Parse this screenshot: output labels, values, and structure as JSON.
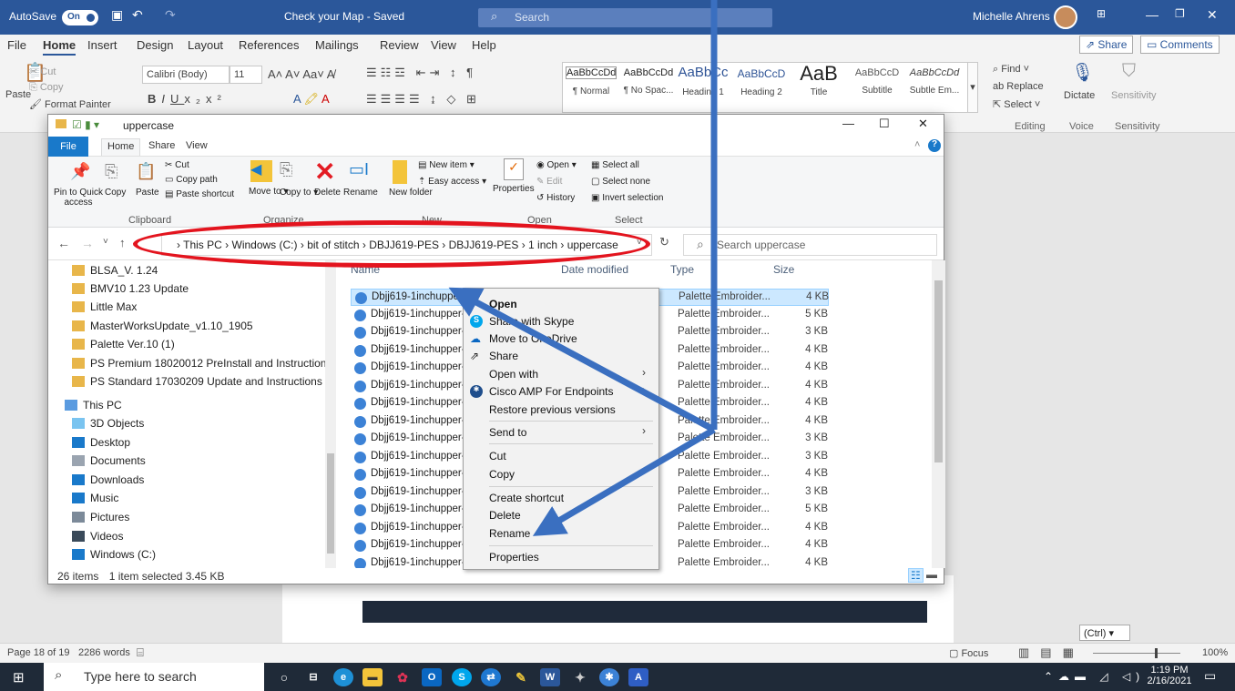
{
  "word": {
    "autosave_label": "AutoSave",
    "autosave_state": "On",
    "doc_title": "Check your Map - Saved",
    "search_placeholder": "Search",
    "user_name": "Michelle Ahrens",
    "menu": [
      "File",
      "Home",
      "Insert",
      "Design",
      "Layout",
      "References",
      "Mailings",
      "Review",
      "View",
      "Help"
    ],
    "share_label": "Share",
    "comments_label": "Comments",
    "clipboard": {
      "paste": "Paste",
      "cut": "Cut",
      "copy": "Copy",
      "format_painter": "Format Painter"
    },
    "font_name": "Calibri (Body)",
    "font_size": "11",
    "styles": [
      {
        "preview": "AaBbCcDd",
        "name": "¶ Normal"
      },
      {
        "preview": "AaBbCcDd",
        "name": "¶ No Spac..."
      },
      {
        "preview": "AaBbCc",
        "name": "Heading 1"
      },
      {
        "preview": "AaBbCcD",
        "name": "Heading 2"
      },
      {
        "preview": "AaB",
        "name": "Title"
      },
      {
        "preview": "AaBbCcD",
        "name": "Subtitle"
      },
      {
        "preview": "AaBbCcDd",
        "name": "Subtle Em..."
      }
    ],
    "editing": {
      "find": "Find",
      "replace": "Replace",
      "select": "Select",
      "group": "Editing"
    },
    "voice": {
      "dictate": "Dictate",
      "group": "Voice"
    },
    "sensitivity": {
      "label": "Sensitivity",
      "group": "Sensitivity"
    },
    "status": {
      "page": "Page 18 of 19",
      "words": "2286 words",
      "focus": "Focus",
      "zoom": "100%"
    },
    "ctrl_tip": "(Ctrl)"
  },
  "explorer": {
    "title": "uppercase",
    "tabs": {
      "file": "File",
      "home": "Home",
      "share": "Share",
      "view": "View"
    },
    "ribbon": {
      "pin": "Pin to Quick access",
      "copy": "Copy",
      "paste": "Paste",
      "cut": "Cut",
      "copy_path": "Copy path",
      "paste_shortcut": "Paste shortcut",
      "move_to": "Move to",
      "copy_to": "Copy to",
      "delete": "Delete",
      "rename": "Rename",
      "new_folder": "New folder",
      "new_item": "New item",
      "easy_access": "Easy access",
      "properties": "Properties",
      "open": "Open",
      "edit": "Edit",
      "history": "History",
      "select_all": "Select all",
      "select_none": "Select none",
      "invert_selection": "Invert selection",
      "groups": {
        "clipboard": "Clipboard",
        "organize": "Organize",
        "new": "New",
        "open": "Open",
        "select": "Select"
      }
    },
    "breadcrumb": [
      "This PC",
      "Windows (C:)",
      "bit of stitch",
      "DBJJ619-PES",
      "DBJJ619-PES",
      "1 inch",
      "uppercase"
    ],
    "search_placeholder": "Search uppercase",
    "nav_items": [
      {
        "label": "BLSA_V. 1.24",
        "icon": "folder-zip-icon"
      },
      {
        "label": "BMV10 1.23 Update",
        "icon": "folder-zip-icon"
      },
      {
        "label": "Little Max",
        "icon": "folder-zip-icon"
      },
      {
        "label": "MasterWorksUpdate_v1.10_1905",
        "icon": "folder-zip-icon"
      },
      {
        "label": "Palette Ver.10 (1)",
        "icon": "folder-zip-icon"
      },
      {
        "label": "PS Premium 18020012 PreInstall and Instructions",
        "icon": "folder-zip-icon"
      },
      {
        "label": "PS Standard 17030209 Update and Instructions",
        "icon": "folder-zip-icon"
      },
      {
        "label": "This PC",
        "icon": "computer-icon"
      },
      {
        "label": "3D Objects",
        "icon": "3d-objects-icon"
      },
      {
        "label": "Desktop",
        "icon": "desktop-icon"
      },
      {
        "label": "Documents",
        "icon": "documents-icon"
      },
      {
        "label": "Downloads",
        "icon": "downloads-icon"
      },
      {
        "label": "Music",
        "icon": "music-icon"
      },
      {
        "label": "Pictures",
        "icon": "pictures-icon"
      },
      {
        "label": "Videos",
        "icon": "videos-icon"
      },
      {
        "label": "Windows (C:)",
        "icon": "drive-icon"
      }
    ],
    "columns": {
      "name": "Name",
      "date": "Date modified",
      "type": "Type",
      "size": "Size"
    },
    "files": [
      {
        "name": "Dbjj619-1inchupper-A",
        "type": "Palette Embroider...",
        "size": "4 KB",
        "selected": true
      },
      {
        "name": "Dbjj619-1inchupper-B",
        "type": "Palette Embroider...",
        "size": "5 KB"
      },
      {
        "name": "Dbjj619-1inchupper-C",
        "type": "Palette Embroider...",
        "size": "3 KB"
      },
      {
        "name": "Dbjj619-1inchupper-D",
        "type": "Palette Embroider...",
        "size": "4 KB"
      },
      {
        "name": "Dbjj619-1inchupper-E",
        "type": "Palette Embroider...",
        "size": "4 KB"
      },
      {
        "name": "Dbjj619-1inchupper-F",
        "type": "Palette Embroider...",
        "size": "4 KB"
      },
      {
        "name": "Dbjj619-1inchupper-G",
        "type": "Palette Embroider...",
        "size": "4 KB"
      },
      {
        "name": "Dbjj619-1inchupper-H",
        "type": "Palette Embroider...",
        "size": "4 KB"
      },
      {
        "name": "Dbjj619-1inchupper-I",
        "type": "Palette Embroider...",
        "size": "3 KB"
      },
      {
        "name": "Dbjj619-1inchupper-J",
        "type": "Palette Embroider...",
        "size": "3 KB"
      },
      {
        "name": "Dbjj619-1inchupper-K",
        "type": "Palette Embroider...",
        "size": "4 KB"
      },
      {
        "name": "Dbjj619-1inchupper-L",
        "type": "Palette Embroider...",
        "size": "3 KB"
      },
      {
        "name": "Dbjj619-1inchupper-M",
        "type": "Palette Embroider...",
        "size": "5 KB"
      },
      {
        "name": "Dbjj619-1inchupper-N",
        "type": "Palette Embroider...",
        "size": "4 KB"
      },
      {
        "name": "Dbjj619-1inchupper-O",
        "type": "Palette Embroider...",
        "size": "4 KB"
      },
      {
        "name": "Dbjj619-1inchupper-P",
        "type": "Palette Embroider...",
        "size": "4 KB"
      }
    ],
    "status": {
      "items": "26 items",
      "selected": "1 item selected 3.45 KB"
    }
  },
  "context_menu": {
    "open": "Open",
    "share_skype": "Share with Skype",
    "onedrive": "Move to OneDrive",
    "share": "Share",
    "open_with": "Open with",
    "cisco": "Cisco AMP For Endpoints",
    "restore": "Restore previous versions",
    "send_to": "Send to",
    "cut": "Cut",
    "copy": "Copy",
    "create_shortcut": "Create shortcut",
    "delete": "Delete",
    "rename": "Rename",
    "properties": "Properties"
  },
  "taskbar": {
    "search_placeholder": "Type here to search",
    "time": "1:19 PM",
    "date": "2/16/2021"
  },
  "colors": {
    "word_blue": "#2b579a",
    "annotation_red": "#e3141e",
    "arrow_blue": "#3a6fc0"
  }
}
